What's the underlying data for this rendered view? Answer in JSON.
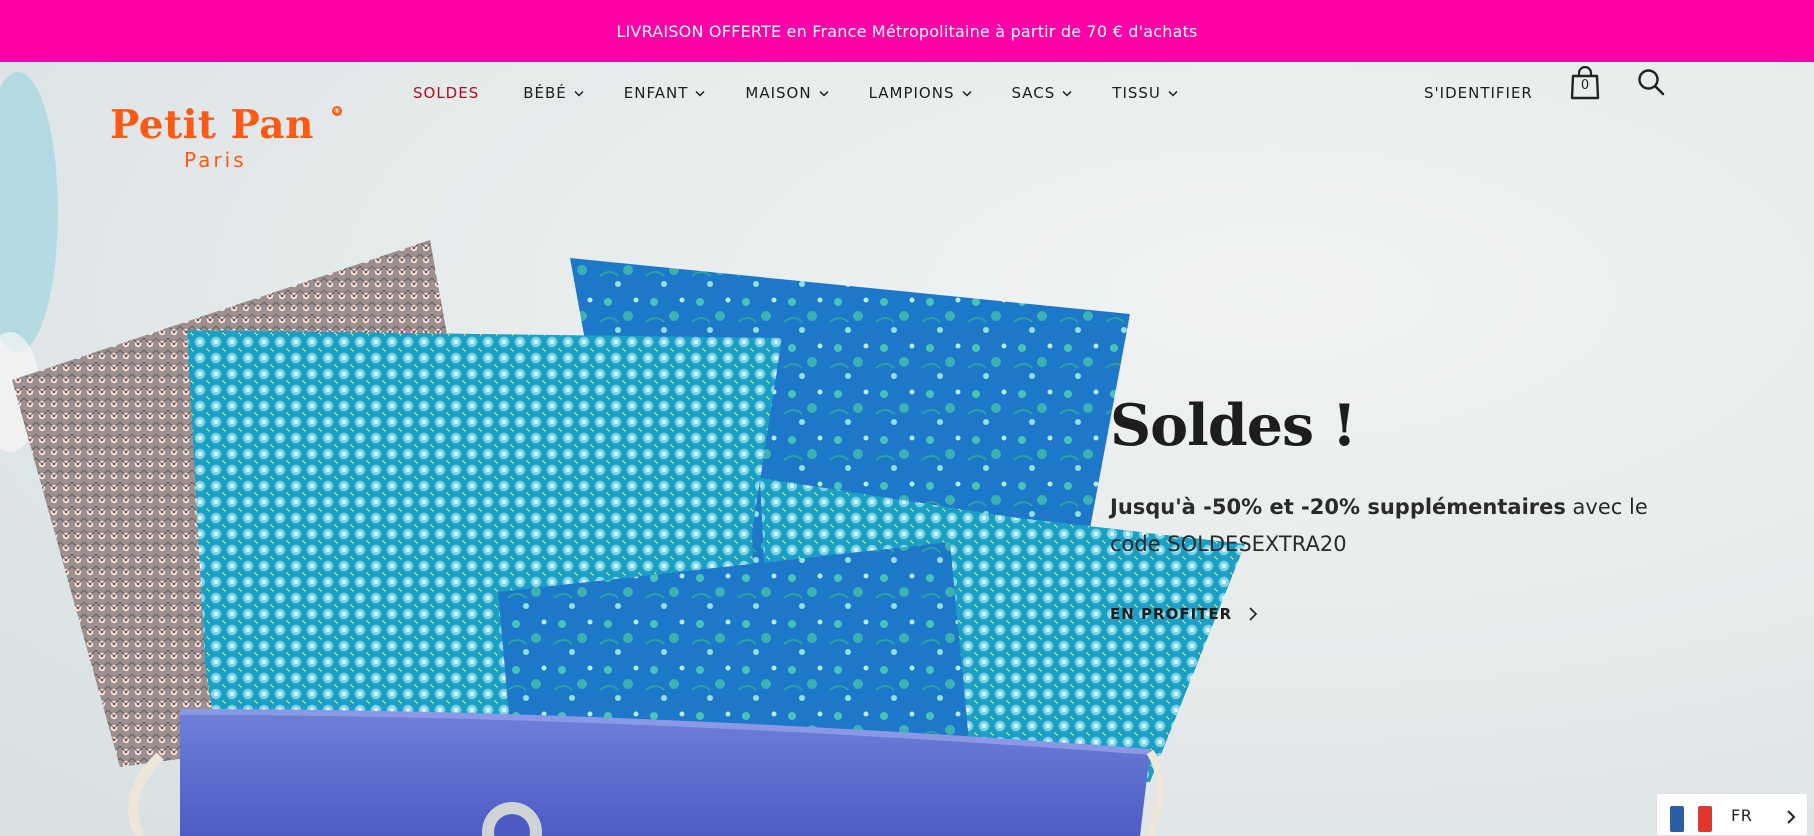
{
  "promo": {
    "text": "LIVRAISON OFFERTE en France Métropolitaine à partir de 70 € d'achats"
  },
  "header": {
    "logo": {
      "brand": "Petit Pan",
      "subtitle": "Paris",
      "registered_mark": "®"
    },
    "nav": [
      {
        "label": "SOLDES",
        "has_dropdown": false,
        "highlight": true
      },
      {
        "label": "BÉBÉ",
        "has_dropdown": true
      },
      {
        "label": "ENFANT",
        "has_dropdown": true
      },
      {
        "label": "MAISON",
        "has_dropdown": true
      },
      {
        "label": "LAMPIONS",
        "has_dropdown": true
      },
      {
        "label": "SACS",
        "has_dropdown": true
      },
      {
        "label": "TISSU",
        "has_dropdown": true
      }
    ],
    "account_label": "S'IDENTIFIER",
    "cart_count": "0",
    "icons": {
      "cart": "shopping-bag-icon",
      "search": "search-icon",
      "dropdown": "chevron-down-icon"
    }
  },
  "hero": {
    "title": "Soldes !",
    "description_bold": "Jusqu'à -50% et -20% supplémentaires",
    "description_rest": " avec le code SOLDESEXTRA20",
    "cta_label": "EN PROFITER",
    "cta_icon": "chevron-right-icon"
  },
  "language": {
    "current": "FR",
    "flag": "france-flag-icon"
  },
  "colors": {
    "promo_bg": "#ff00a8",
    "brand_orange": "#ff5a14",
    "sale_red": "#a8101c",
    "text_dark": "#1e1e1e"
  }
}
